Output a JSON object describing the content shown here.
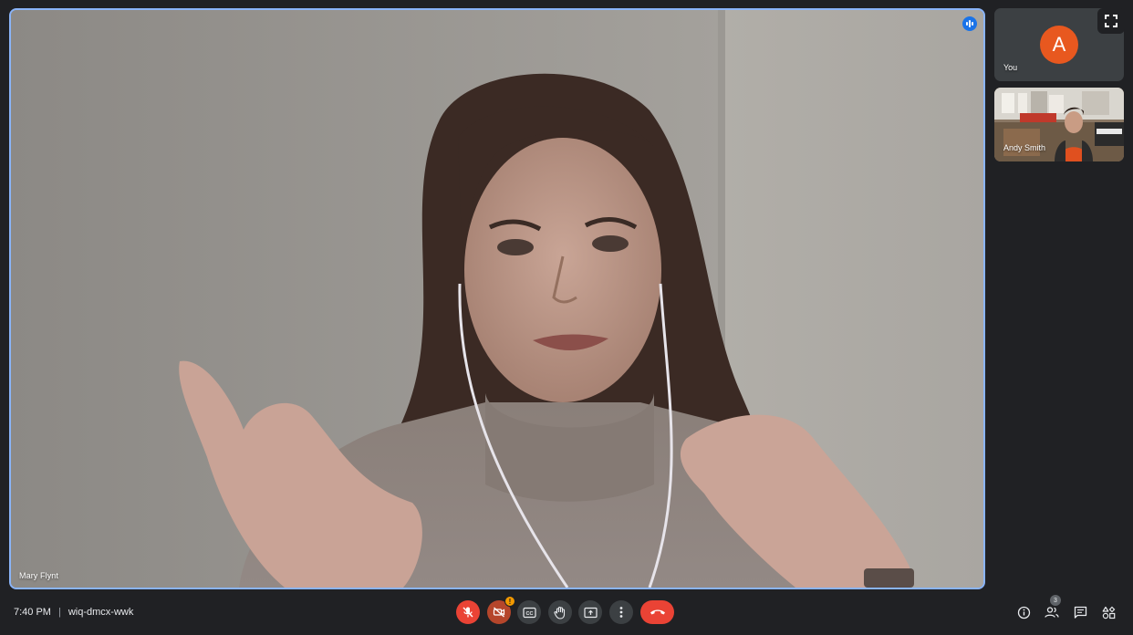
{
  "meeting": {
    "time": "7:40 PM",
    "separator": "|",
    "code": "wiq-dmcx-wwk"
  },
  "main_tile": {
    "participant_name": "Mary Flynt",
    "speaking": true
  },
  "side_tiles": {
    "you": {
      "avatar_letter": "A",
      "name": "You",
      "avatar_color": "#e8581f"
    },
    "andy": {
      "name": "Andy Smith"
    }
  },
  "controls": {
    "mic": {
      "icon": "mic-off-icon",
      "state": "off"
    },
    "camera": {
      "icon": "camera-off-icon",
      "state": "off",
      "warning": "!"
    },
    "captions": {
      "icon": "cc-icon",
      "label": "CC"
    },
    "raise_hand": {
      "icon": "hand-icon"
    },
    "present": {
      "icon": "present-screen-icon"
    },
    "more": {
      "icon": "more-vert-icon"
    },
    "hangup": {
      "icon": "call-end-icon"
    }
  },
  "side_controls": {
    "info": {
      "icon": "info-icon"
    },
    "people": {
      "icon": "people-icon",
      "count": "3"
    },
    "chat": {
      "icon": "chat-icon"
    },
    "activities": {
      "icon": "activities-icon"
    }
  },
  "colors": {
    "background": "#202124",
    "active_border": "#8ab4f8",
    "danger": "#ea4335",
    "warning": "#f29900",
    "speaking": "#1a73e8"
  }
}
